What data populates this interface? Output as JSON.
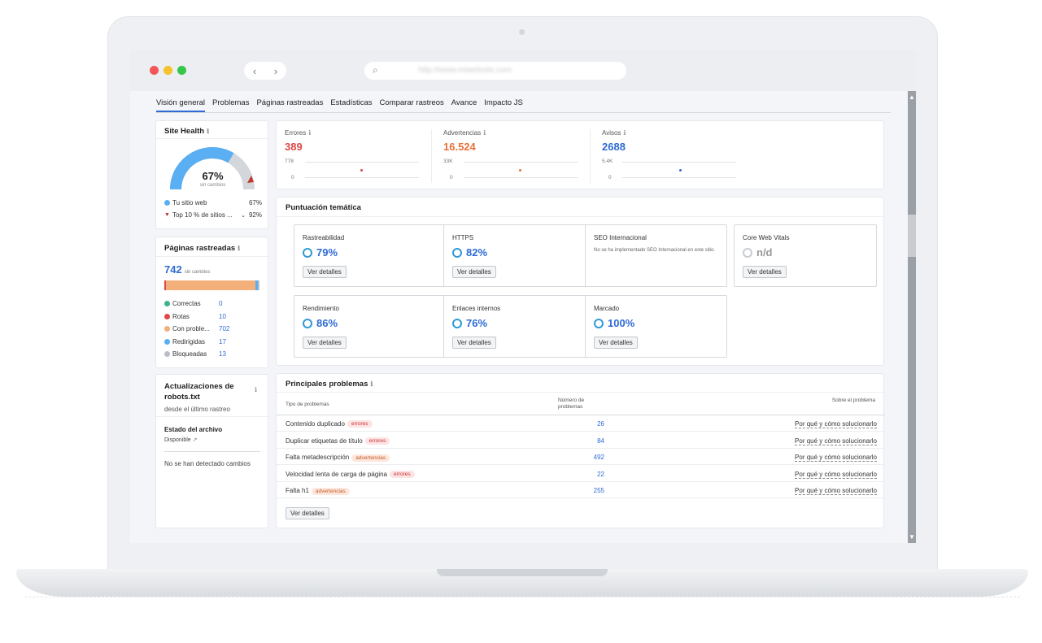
{
  "browser": {
    "url": "http://www.miwebsite.com"
  },
  "tabs": [
    "Visión general",
    "Problemas",
    "Páginas rastreadas",
    "Estadísticas",
    "Comparar rastreos",
    "Avance",
    "Impacto JS"
  ],
  "site_health": {
    "title": "Site Health",
    "value": "67%",
    "sub": "sin cambios",
    "gauge_fraction": 0.67,
    "legend": [
      {
        "label": "Tu sitio web",
        "value": "67%"
      },
      {
        "label": "Top 10 % de sitios ...",
        "value": "92%"
      }
    ]
  },
  "crawled": {
    "title": "Páginas rastreadas",
    "total": "742",
    "sub": "sin cambios",
    "items": [
      {
        "label": "Correctas",
        "value": "0",
        "color": "#3eb489"
      },
      {
        "label": "Rotas",
        "value": "10",
        "color": "#e04848"
      },
      {
        "label": "Con proble...",
        "value": "702",
        "color": "#f4b07a"
      },
      {
        "label": "Redirigidas",
        "value": "17",
        "color": "#5aaef2"
      },
      {
        "label": "Bloqueadas",
        "value": "13",
        "color": "#b9bec6"
      }
    ]
  },
  "robots": {
    "title": "Actualizaciones de robots.txt",
    "sub": "desde el último rastreo",
    "file_state_label": "Estado del archivo",
    "file_state_value": "Disponible",
    "no_changes": "No se han detectado cambios"
  },
  "metrics": [
    {
      "name": "Errores",
      "value": "389",
      "color": "#e04848",
      "top": "778",
      "zero": "0"
    },
    {
      "name": "Advertencias",
      "value": "16.524",
      "color": "#e8703a",
      "top": "33K",
      "zero": "0"
    },
    {
      "name": "Avisos",
      "value": "2688",
      "color": "#2e6bd3",
      "top": "5.4K",
      "zero": "0"
    }
  ],
  "thematic": {
    "title": "Puntuación temática",
    "btn": "Ver detalles",
    "cards": [
      {
        "name": "Rastreabilidad",
        "value": "79%"
      },
      {
        "name": "HTTPS",
        "value": "82%"
      },
      {
        "name": "SEO Internacional",
        "note": "No se ha implementado SEO Internacional en este sitio."
      },
      {
        "name": "Core Web Vitals",
        "value": "n/d"
      },
      {
        "name": "Rendimiento",
        "value": "86%"
      },
      {
        "name": "Enlaces internos",
        "value": "76%"
      },
      {
        "name": "Marcado",
        "value": "100%"
      }
    ]
  },
  "problems": {
    "title": "Principales problemas",
    "col_type": "Tipo de problemas",
    "col_count": "Número de problemas",
    "col_about": "Sobre el problema",
    "link": "Por qué y cómo solucionarlo",
    "btn": "Ver detalles",
    "rows": [
      {
        "name": "Contenido duplicado",
        "tag": "errores",
        "kind": "err",
        "count": "26"
      },
      {
        "name": "Duplicar etiquetas de título",
        "tag": "errores",
        "kind": "err",
        "count": "84"
      },
      {
        "name": "Falta metadescripción",
        "tag": "advertencias",
        "kind": "warn",
        "count": "492"
      },
      {
        "name": "Velocidad lenta de carga de página",
        "tag": "errores",
        "kind": "err",
        "count": "22"
      },
      {
        "name": "Falta h1",
        "tag": "advertencias",
        "kind": "warn",
        "count": "255"
      }
    ]
  }
}
